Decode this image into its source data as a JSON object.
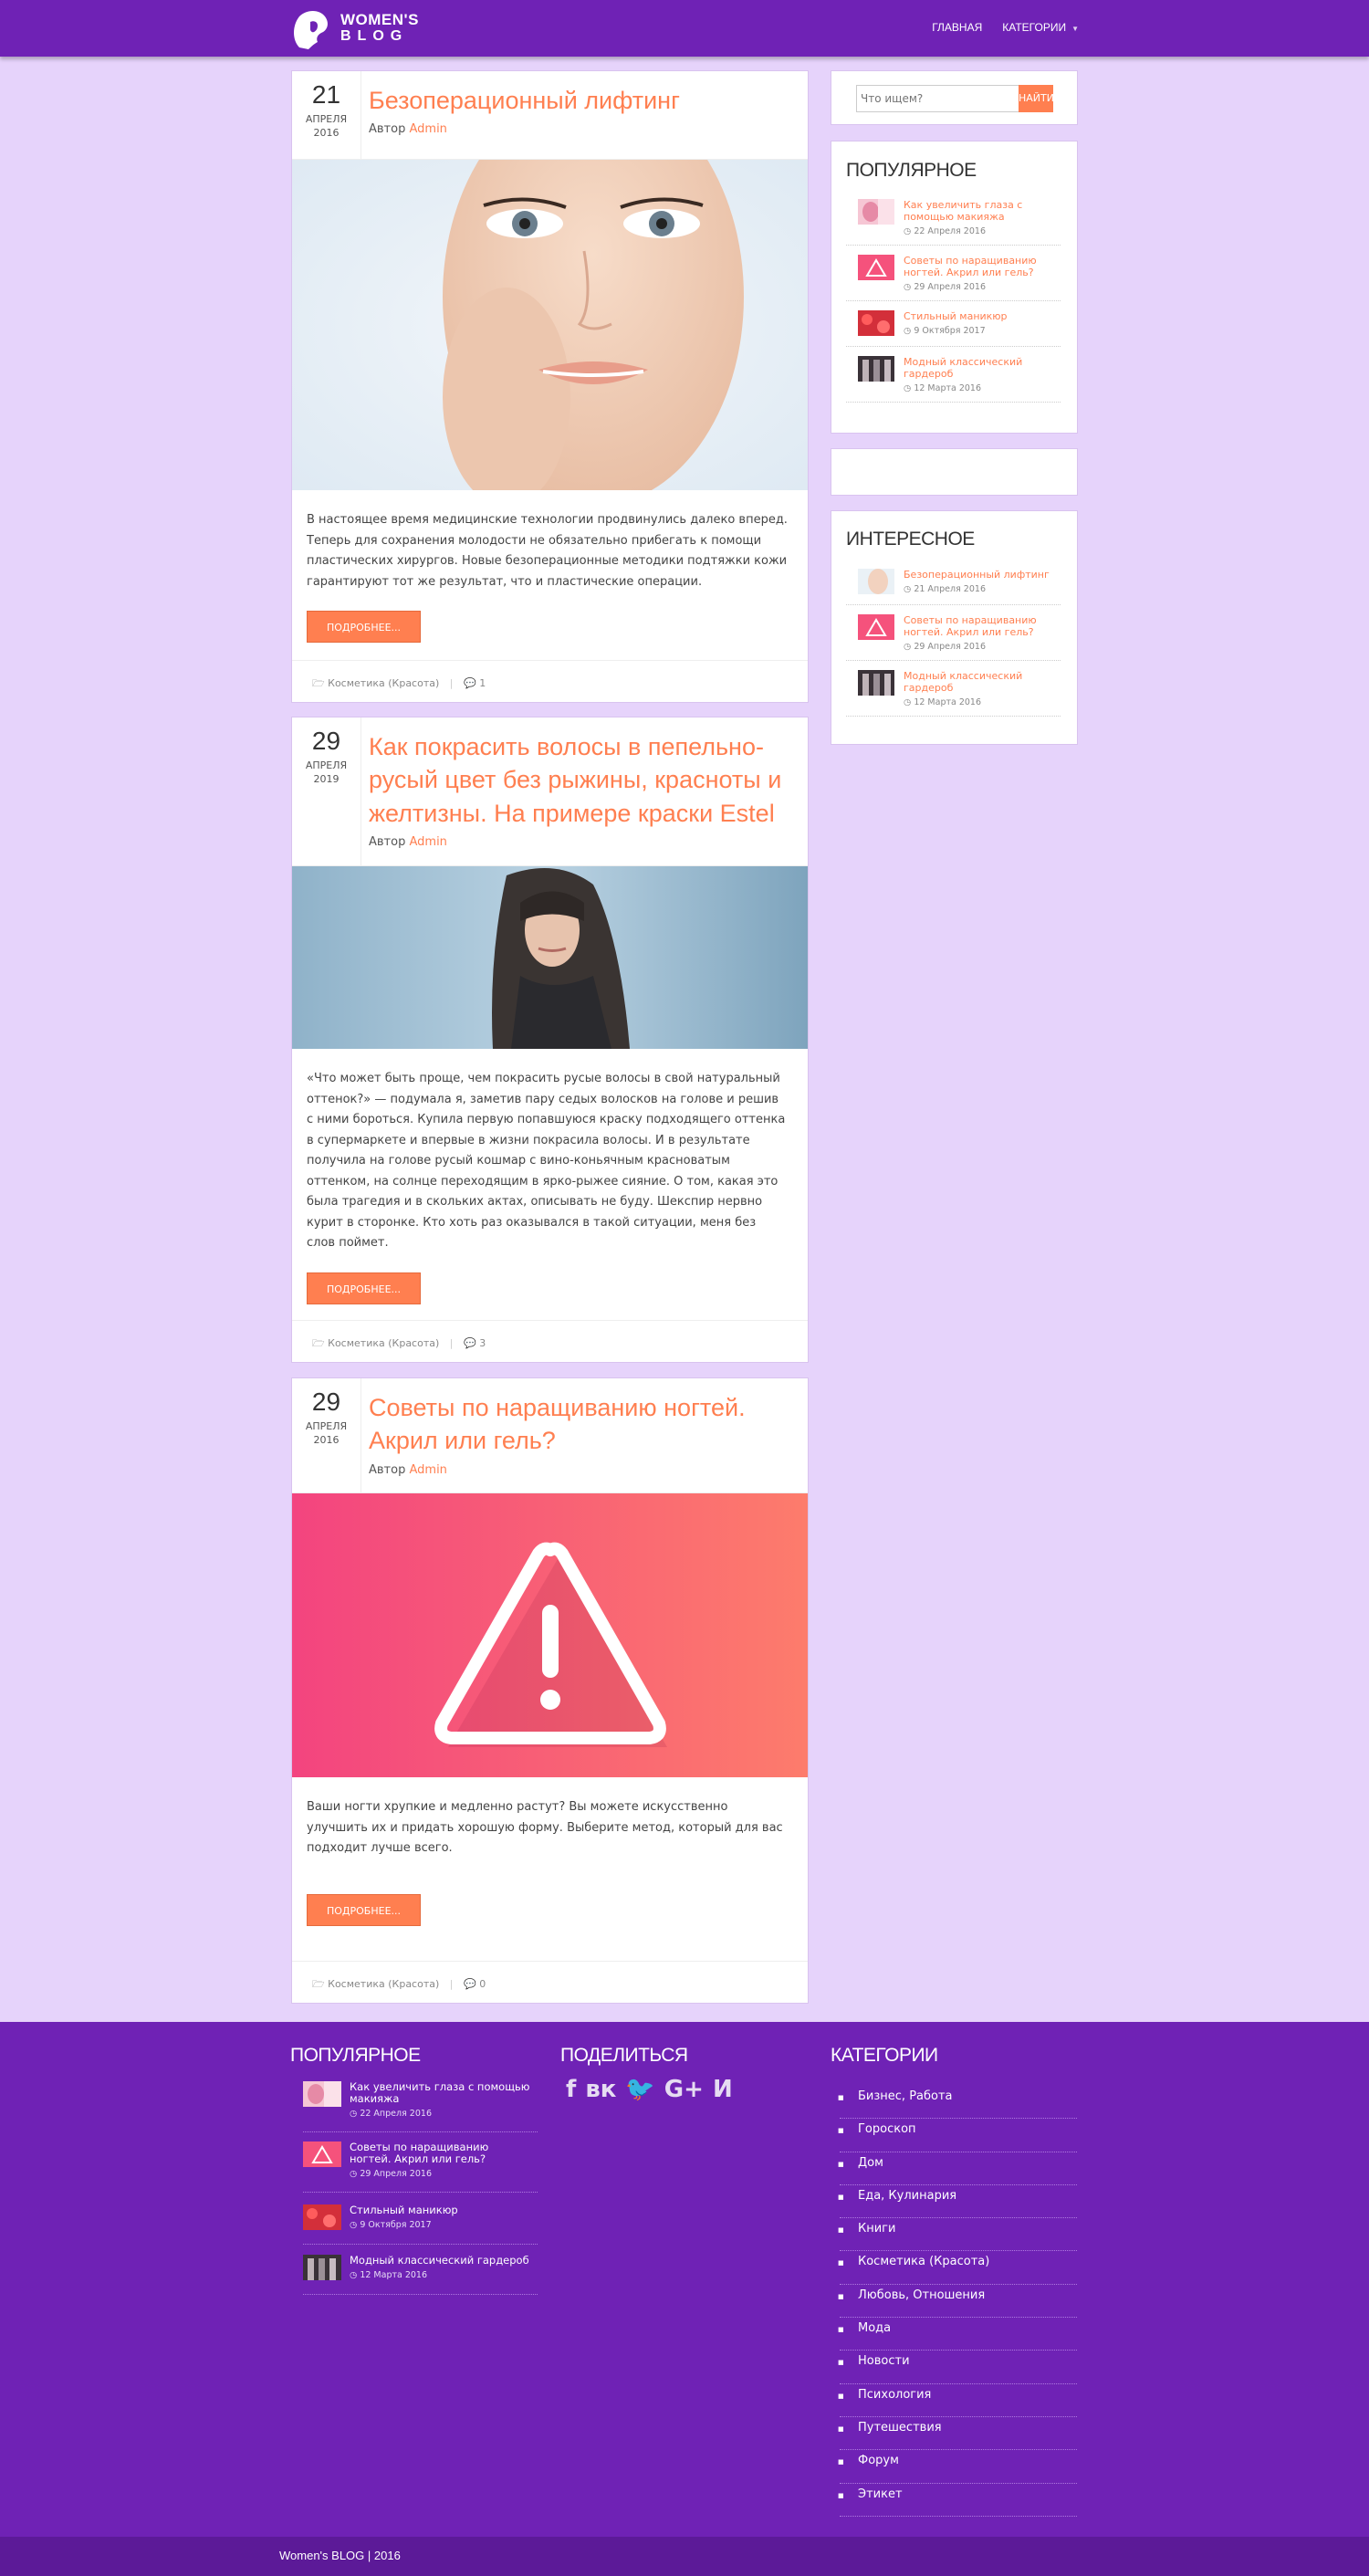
{
  "header": {
    "logo_line1": "WOMEN'S",
    "logo_line2": "BLOG",
    "nav": [
      "ГЛАВНАЯ",
      "КАТЕГОРИИ"
    ]
  },
  "posts": [
    {
      "day": "21",
      "month": "АПРЕЛЯ",
      "year": "2016",
      "title": "Безоперационный лифтинг",
      "author_label": "Автор",
      "author": "Admin",
      "text": "В настоящее время медицинские технологии продвинулись далеко вперед. Теперь для сохранения молодости не обязательно прибегать к помощи пластических хирургов. Новые безоперационные методики подтяжки кожи гарантируют тот же результат, что и пластические операции.",
      "more": "ПОДРОБНЕЕ...",
      "category": "Косметика (Красота)",
      "comments": "1"
    },
    {
      "day": "29",
      "month": "АПРЕЛЯ",
      "year": "2019",
      "title": "Как покрасить волосы в пепельно-русый цвет без рыжины, красноты и желтизны. На примере краски Estel",
      "author_label": "Автор",
      "author": "Admin",
      "text": "«Что может быть проще, чем покрасить русые волосы в свой натуральный оттенок?» — подумала я, заметив пару седых волосков на голове и решив с ними бороться. Купила первую попавшуюся краску подходящего оттенка в супермаркете и впервые в жизни покрасила волосы. И в результате получила на голове русый кошмар с вино-коньячным красноватым оттенком, на солнце переходящим в ярко-рыжее сияние. О том, какая это была трагедия и в скольких актах, описывать не буду. Шекспир нервно курит в сторонке. Кто хоть раз оказывался в такой ситуации, меня без слов поймет.",
      "more": "ПОДРОБНЕЕ...",
      "category": "Косметика (Красота)",
      "comments": "3"
    },
    {
      "day": "29",
      "month": "АПРЕЛЯ",
      "year": "2016",
      "title": "Советы по наращиванию ногтей. Акрил или гель?",
      "author_label": "Автор",
      "author": "Admin",
      "text": "Ваши ногти хрупкие и медленно растут? Вы можете искусственно улучшить их и придать хорошую форму. Выберите метод, который для вас подходит лучше всего.",
      "more": "ПОДРОБНЕЕ...",
      "category": "Косметика (Красота)",
      "comments": "0"
    }
  ],
  "sidebar": {
    "search_placeholder": "Что ищем?",
    "search_button": "НАЙТИ",
    "popular_title": "ПОПУЛЯРНОЕ",
    "popular": [
      {
        "title": "Как увеличить глаза с помощью макияжа",
        "date": "22 Апреля 2016"
      },
      {
        "title": "Советы по наращиванию ногтей. Акрил или гель?",
        "date": "29 Апреля 2016"
      },
      {
        "title": "Стильный маникюр",
        "date": "9 Октября 2017"
      },
      {
        "title": "Модный классический гардероб",
        "date": "12 Марта 2016"
      }
    ],
    "interesting_title": "ИНТЕРЕСНОЕ",
    "interesting": [
      {
        "title": "Безоперационный лифтинг",
        "date": "21 Апреля 2016"
      },
      {
        "title": "Советы по наращиванию ногтей. Акрил или гель?",
        "date": "29 Апреля 2016"
      },
      {
        "title": "Модный классический гардероб",
        "date": "12 Марта 2016"
      }
    ]
  },
  "footer": {
    "popular_title": "ПОПУЛЯРНОЕ",
    "popular": [
      {
        "title": "Как увеличить глаза с помощью макияжа",
        "date": "22 Апреля 2016"
      },
      {
        "title": "Советы по наращиванию ногтей. Акрил или гель?",
        "date": "29 Апреля 2016"
      },
      {
        "title": "Стильный маникюр",
        "date": "9 Октября 2017"
      },
      {
        "title": "Модный классический гардероб",
        "date": "12 Марта 2016"
      }
    ],
    "share_title": "ПОДЕЛИТЬСЯ",
    "share_icons": [
      "f",
      "vk",
      "t",
      "G+",
      "ok"
    ],
    "categories_title": "КАТЕГОРИИ",
    "categories": [
      "Бизнес, Работа",
      "Гороскоп",
      "Дом",
      "Еда, Кулинария",
      "Книги",
      "Косметика (Красота)",
      "Любовь, Отношения",
      "Мода",
      "Новости",
      "Психология",
      "Путешествия",
      "Форум",
      "Этикет"
    ]
  },
  "copyright": "Women's BLOG | 2016",
  "colors": {
    "brand": "#6f22b5",
    "accent": "#ff7f50",
    "background": "#e6d3fb"
  }
}
